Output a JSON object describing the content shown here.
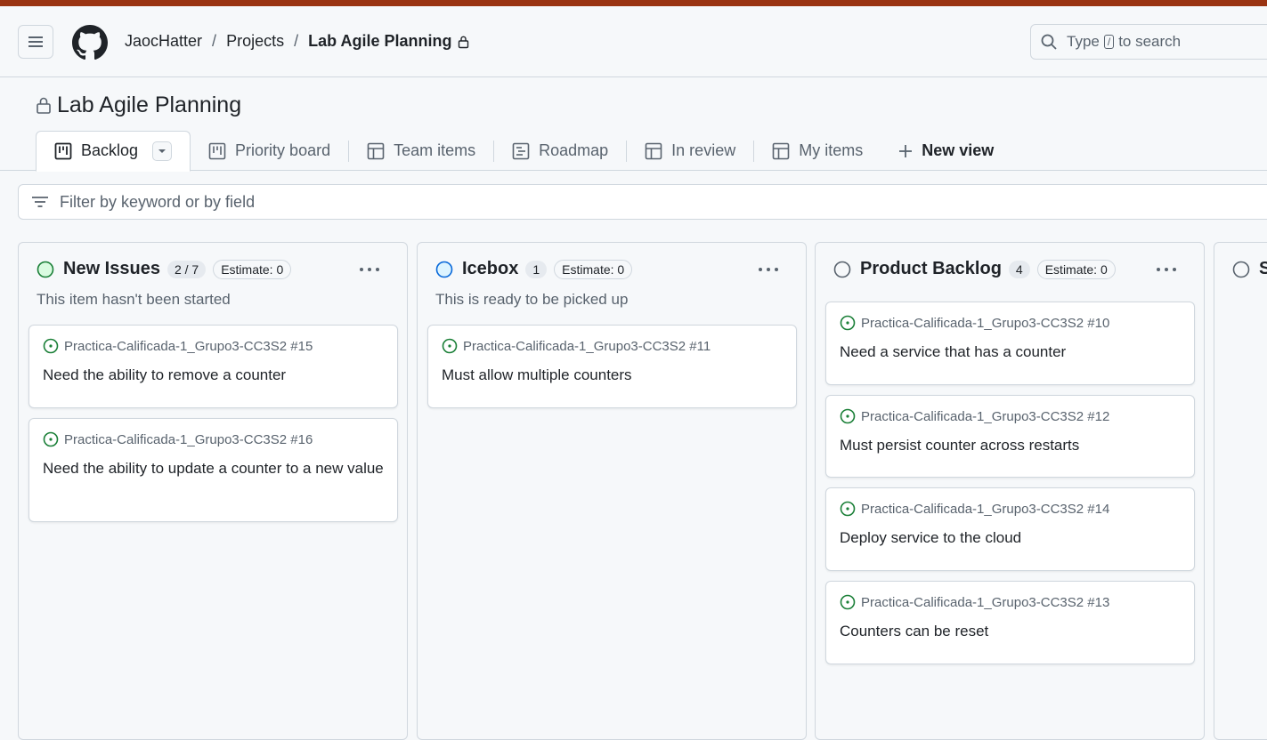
{
  "header": {
    "owner": "JaocHatter",
    "section": "Projects",
    "project": "Lab Agile Planning",
    "search_text_before": "Type",
    "search_kbd": "/",
    "search_text_after": "to search"
  },
  "page_title": "Lab Agile Planning",
  "tabs": [
    {
      "label": "Backlog",
      "icon": "board-icon"
    },
    {
      "label": "Priority board",
      "icon": "board-icon"
    },
    {
      "label": "Team items",
      "icon": "table-icon"
    },
    {
      "label": "Roadmap",
      "icon": "roadmap-icon"
    },
    {
      "label": "In review",
      "icon": "table-icon"
    },
    {
      "label": "My items",
      "icon": "table-icon"
    }
  ],
  "new_view_label": "New view",
  "filter_placeholder": "Filter by keyword or by field",
  "columns": [
    {
      "name": "New Issues",
      "count": "2 / 7",
      "estimate": "Estimate: 0",
      "description": "This item hasn't been started",
      "status_color": "#1a7f37",
      "cards": [
        {
          "repo": "Practica-Calificada-1_Grupo3-CC3S2 #15",
          "title": "Need the ability to remove a counter"
        },
        {
          "repo": "Practica-Calificada-1_Grupo3-CC3S2 #16",
          "title": "Need the ability to update a counter to a new value"
        }
      ]
    },
    {
      "name": "Icebox",
      "count": "1",
      "estimate": "Estimate: 0",
      "description": "This is ready to be picked up",
      "status_color": "#0969da",
      "cards": [
        {
          "repo": "Practica-Calificada-1_Grupo3-CC3S2 #11",
          "title": "Must allow multiple counters"
        }
      ]
    },
    {
      "name": "Product Backlog",
      "count": "4",
      "estimate": "Estimate: 0",
      "description": "",
      "status_color": "#59636e",
      "cards": [
        {
          "repo": "Practica-Calificada-1_Grupo3-CC3S2 #10",
          "title": "Need a service that has a counter"
        },
        {
          "repo": "Practica-Calificada-1_Grupo3-CC3S2 #12",
          "title": "Must persist counter across restarts"
        },
        {
          "repo": "Practica-Calificada-1_Grupo3-CC3S2 #14",
          "title": "Deploy service to the cloud"
        },
        {
          "repo": "Practica-Calificada-1_Grupo3-CC3S2 #13",
          "title": "Counters can be reset"
        }
      ]
    },
    {
      "name": "S",
      "status_color": "#59636e"
    }
  ],
  "colors": {
    "accent_stripe": "#9a3412",
    "open_issue": "#1a7f37"
  }
}
